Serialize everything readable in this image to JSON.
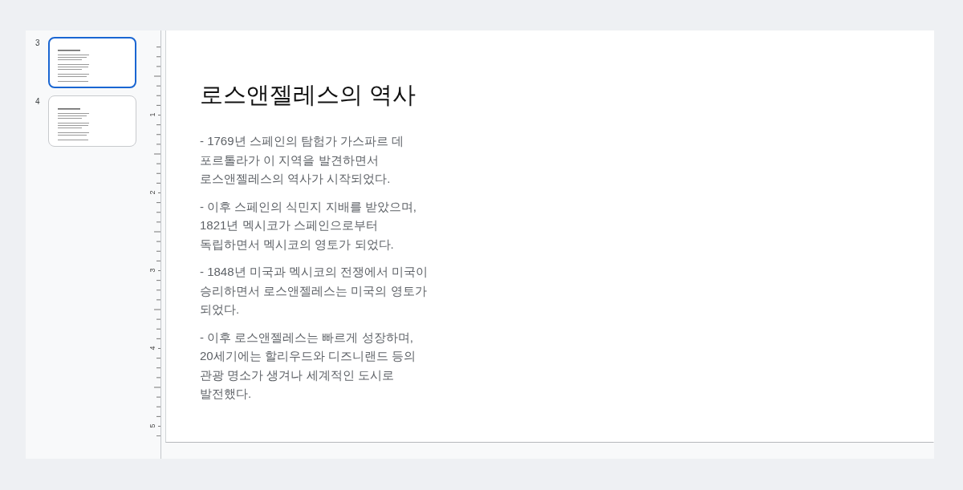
{
  "slide_panel": {
    "thumbnails": [
      {
        "number": "3",
        "selected": true
      },
      {
        "number": "4",
        "selected": false
      }
    ]
  },
  "ruler": {
    "numbers": [
      "1",
      "2",
      "3",
      "4",
      "5"
    ]
  },
  "slide": {
    "title": "로스앤젤레스의 역사",
    "paragraphs": [
      "- 1769년 스페인의 탐험가 가스파르 데\n포르톨라가 이 지역을 발견하면서\n로스앤젤레스의 역사가 시작되었다.",
      "- 이후 스페인의 식민지 지배를 받았으며,\n1821년 멕시코가 스페인으로부터\n독립하면서 멕시코의 영토가 되었다.",
      "- 1848년 미국과 멕시코의 전쟁에서 미국이\n승리하면서 로스앤젤레스는 미국의 영토가\n되었다.",
      "- 이후 로스앤젤레스는 빠르게 성장하며,\n20세기에는 할리우드와 디즈니랜드 등의\n관광 명소가 생겨나 세계적인 도시로\n발전했다."
    ]
  }
}
